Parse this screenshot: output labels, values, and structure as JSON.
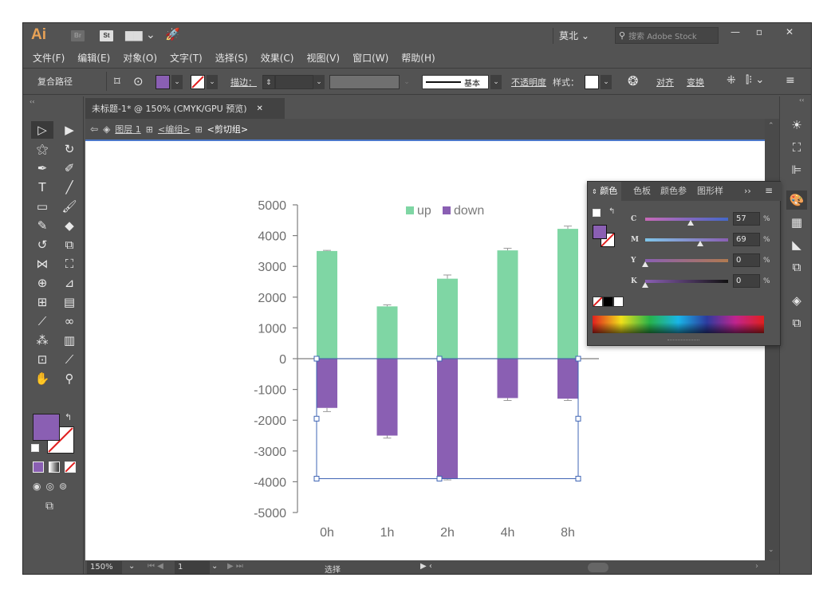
{
  "titlebar": {
    "logo": "Ai",
    "br": "Br",
    "st": "St",
    "workspace": "莫北",
    "search_placeholder": "搜索 Adobe Stock"
  },
  "menu": [
    "文件(F)",
    "编辑(E)",
    "对象(O)",
    "文字(T)",
    "选择(S)",
    "效果(C)",
    "视图(V)",
    "窗口(W)",
    "帮助(H)"
  ],
  "control": {
    "selection_type": "复合路径",
    "stroke_label": "描边：",
    "brush_label": "基本",
    "opacity_label": "不透明度",
    "style_label": "样式：",
    "align_label": "对齐",
    "transform_label": "变换"
  },
  "document": {
    "tab_title": "未标题-1* @ 150% (CMYK/GPU 预览)",
    "crumbs": [
      "图层 1",
      "<编组>",
      "<剪切组>"
    ]
  },
  "status": {
    "zoom": "150%",
    "artboard": "1",
    "tool": "选择"
  },
  "color_panel": {
    "tabs": [
      "颜色",
      "色板",
      "颜色参",
      "图形样"
    ],
    "channels": [
      {
        "label": "C",
        "value": "57"
      },
      {
        "label": "M",
        "value": "69"
      },
      {
        "label": "Y",
        "value": "0"
      },
      {
        "label": "K",
        "value": "0"
      }
    ],
    "pct": "%",
    "fill_color": "#8a5fb3"
  },
  "colors": {
    "up": "#7fd6a4",
    "down": "#8a5fb3",
    "selection": "#3f64b4"
  },
  "chart_data": {
    "type": "bar",
    "categories": [
      "0h",
      "1h",
      "2h",
      "4h",
      "8h"
    ],
    "series": [
      {
        "name": "up",
        "values": [
          3500,
          1700,
          2600,
          3520,
          4220
        ],
        "errors": [
          20,
          50,
          120,
          70,
          90
        ]
      },
      {
        "name": "down",
        "values": [
          -1600,
          -2500,
          -3900,
          -1280,
          -1300
        ],
        "errors": [
          120,
          80,
          40,
          80,
          60
        ]
      }
    ],
    "yticks": [
      "5000",
      "4000",
      "3000",
      "2000",
      "1000",
      "0",
      "-1000",
      "-2000",
      "-3000",
      "-4000",
      "-5000"
    ],
    "ylim": [
      -5000,
      5000
    ],
    "legend": "top-center",
    "grid": false
  }
}
